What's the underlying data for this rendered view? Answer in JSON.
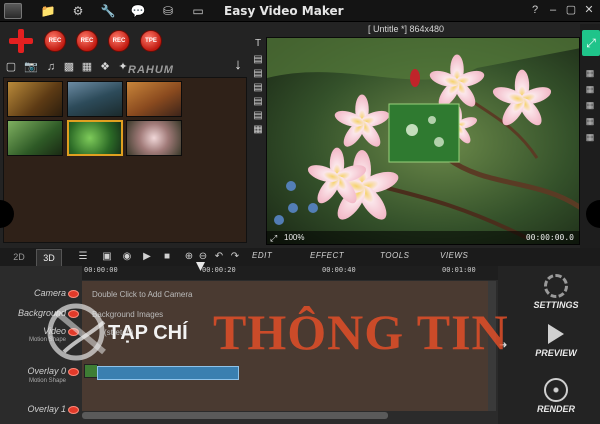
{
  "window": {
    "title": "Easy Video Maker",
    "controls": [
      "?",
      "–",
      "▢",
      "✕"
    ],
    "toolbar_icons": [
      "folder-icon",
      "gear-icon",
      "wrench-icon",
      "comment-icon",
      "database-icon",
      "exit-icon"
    ]
  },
  "record_buttons": [
    "REC",
    "REC",
    "REC",
    "TPE"
  ],
  "media_tabs": [
    "video-tab-icon",
    "camera-tab-icon",
    "music-tab-icon",
    "image-tab-icon",
    "picture-tab-icon",
    "effect-tab-icon",
    "puzzle-tab-icon"
  ],
  "brand_text": "RAHUM",
  "preview": {
    "header": "[ Untitle *]   864x480",
    "zoom": "100%",
    "time": "00:00:00.0"
  },
  "timeline": {
    "tabs": [
      "2D",
      "3D"
    ],
    "menus": [
      "EDIT",
      "EFFECT",
      "TOOLS",
      "VIEWS"
    ],
    "ruler": [
      "00:00:00",
      "00:00:20",
      "00:00:40",
      "00:01:00"
    ],
    "tracks": [
      {
        "label": "Camera",
        "sub": "",
        "hint": "Double Click to Add Camera"
      },
      {
        "label": "Background",
        "sub": "",
        "hint": "Background Images"
      },
      {
        "label": "Video",
        "sub": "Motion Shape",
        "hint": "(stretch)"
      },
      {
        "label": "Overlay 0",
        "sub": "Motion Shape",
        "hint": ""
      },
      {
        "label": "Overlay 1",
        "sub": "",
        "hint": ""
      }
    ]
  },
  "actions": [
    {
      "label": "SETTINGS",
      "icon": "gear-icon"
    },
    {
      "label": "PREVIEW",
      "icon": "play-icon"
    },
    {
      "label": "RENDER",
      "icon": "film-reel-icon"
    }
  ],
  "watermark": {
    "small": "TẠP CHÍ",
    "big": "THÔNG TIN"
  },
  "colors": {
    "accent_red": "#e42020",
    "panel_dark": "#232323",
    "library_bg": "#2f2118",
    "green_tab": "#1fc48a"
  }
}
